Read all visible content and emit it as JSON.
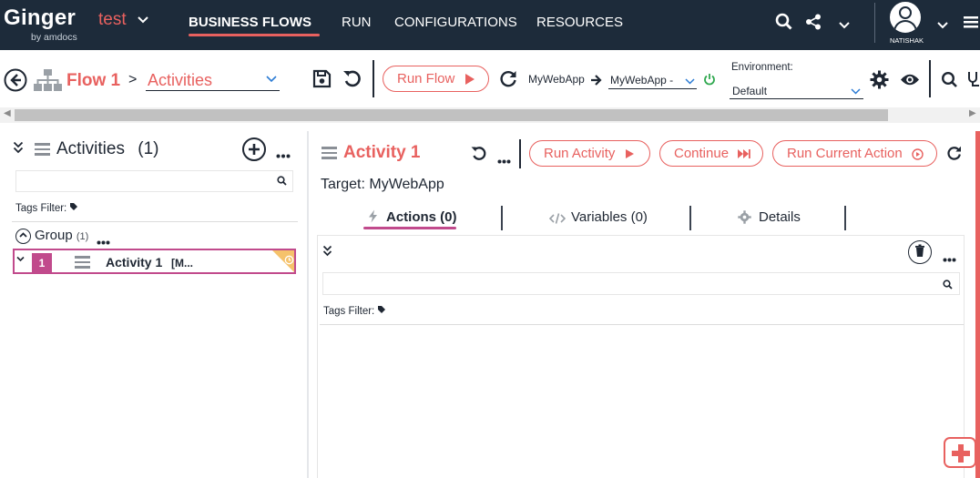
{
  "topbar": {
    "logo": "Ginger",
    "logo_sub": "by amdocs",
    "solution_name": "test",
    "nav": [
      "BUSINESS FLOWS",
      "RUN",
      "CONFIGURATIONS",
      "RESOURCES"
    ],
    "active_nav": "BUSINESS FLOWS",
    "user_name": "NATISHAK",
    "accent_color": "#e8615f",
    "bar_color": "#1d2b3a"
  },
  "toolbar": {
    "flow_name": "Flow 1",
    "breadcrumb_separator": ">",
    "page_selected": "Activities",
    "run_flow_label": "Run Flow",
    "target_app": "MyWebApp",
    "target_app_selected": "MyWebApp -",
    "environment_label": "Environment:",
    "environment_selected": "Default"
  },
  "activities_panel": {
    "title": "Activities",
    "count": "(1)",
    "tags_filter_label": "Tags Filter:",
    "group_name": "Group",
    "group_count": "(1)",
    "items": [
      {
        "number": "1",
        "name": "Activity 1",
        "suffix": "[M..."
      }
    ]
  },
  "activity_detail": {
    "title": "Activity 1",
    "target_label": "Target: MyWebApp",
    "run_activity_label": "Run Activity",
    "continue_label": "Continue",
    "run_current_action_label": "Run Current Action",
    "tabs": [
      "Actions (0)",
      "Variables (0)",
      "Details"
    ],
    "active_tab": "Actions (0)",
    "tags_filter_label": "Tags Filter:"
  },
  "icons": {
    "back": "arrow-left-circle-icon",
    "flow": "sitemap-icon",
    "save": "save-icon",
    "undo": "undo-icon",
    "refresh": "refresh-icon",
    "power": "power-icon",
    "settings": "gear-icon",
    "view": "eye-icon",
    "search": "search-icon",
    "share": "share-icon"
  }
}
